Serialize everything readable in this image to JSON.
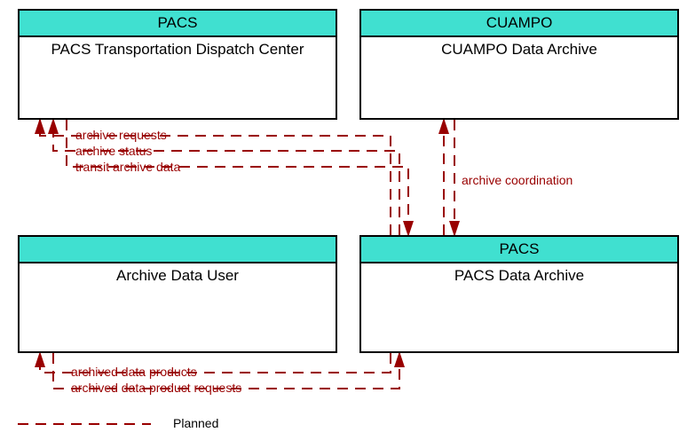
{
  "boxes": {
    "top_left": {
      "header": "PACS",
      "title": "PACS Transportation Dispatch Center"
    },
    "top_right": {
      "header": "CUAMPO",
      "title": "CUAMPO Data Archive"
    },
    "bottom_left": {
      "header": "",
      "title": "Archive Data User"
    },
    "bottom_right": {
      "header": "PACS",
      "title": "PACS Data Archive"
    }
  },
  "flows": {
    "f1": "archive requests",
    "f2": "archive status",
    "f3": "transit archive data",
    "f4": "archive coordination",
    "f5": "archived data products",
    "f6": "archived data product requests"
  },
  "legend": {
    "planned": "Planned"
  },
  "colors": {
    "line": "#990000",
    "header_bg": "#40E0D0"
  }
}
